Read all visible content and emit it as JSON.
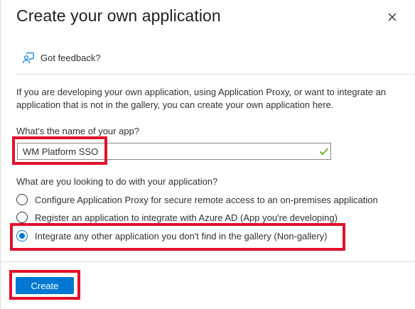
{
  "dialog": {
    "title": "Create your own application",
    "feedback_label": "Got feedback?",
    "intro_text": "If you are developing your own application, using Application Proxy, or want to integrate an application that is not in the gallery, you can create your own application here.",
    "name_question": "What's the name of your app?",
    "name_value": "WM Platform SSO",
    "name_valid": true,
    "purpose_question": "What are you looking to do with your application?",
    "options": [
      {
        "label": "Configure Application Proxy for secure remote access to an on-premises application",
        "selected": false
      },
      {
        "label": "Register an application to integrate with Azure AD (App you're developing)",
        "selected": false
      },
      {
        "label": "Integrate any other application you don't find in the gallery (Non-gallery)",
        "selected": true
      }
    ],
    "create_label": "Create"
  },
  "icons": {
    "close": "close-icon",
    "feedback": "feedback-person-icon",
    "valid": "checkmark-icon"
  },
  "colors": {
    "accent": "#0078d4",
    "valid": "#57a300",
    "highlight": "#e3102c"
  }
}
